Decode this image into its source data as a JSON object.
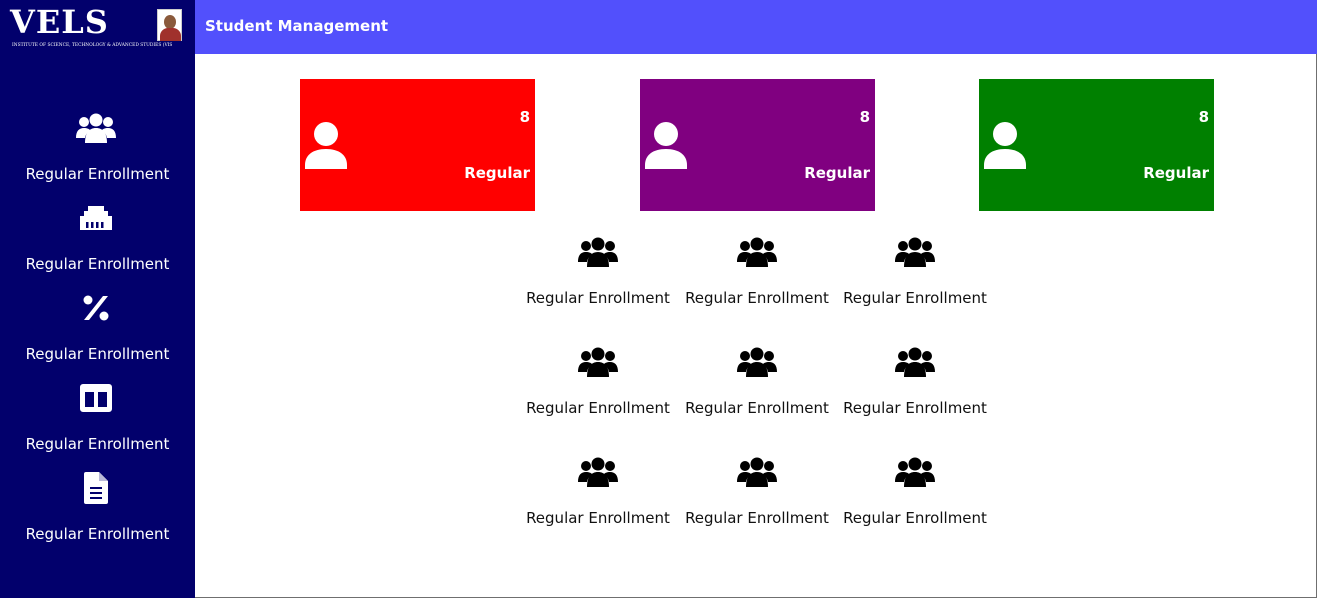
{
  "logo": {
    "text": "VELS",
    "subtitle": "INSTITUTE OF SCIENCE, TECHNOLOGY & ADVANCED STUDIES (VISTAS)"
  },
  "header": {
    "title": "Student Management"
  },
  "sidebar": {
    "items": [
      {
        "label": "Regular Enrollment",
        "icon": "users-icon"
      },
      {
        "label": "Regular Enrollment",
        "icon": "ethernet-port-icon"
      },
      {
        "label": "Regular Enrollment",
        "icon": "percent-icon"
      },
      {
        "label": "Regular Enrollment",
        "icon": "columns-icon"
      },
      {
        "label": "Regular Enrollment",
        "icon": "document-icon"
      }
    ]
  },
  "cards": [
    {
      "count": "8",
      "title": "Regular",
      "color": "#ff0000",
      "icon": "user-icon"
    },
    {
      "count": "8",
      "title": "Regular",
      "color": "#800080",
      "icon": "user-icon"
    },
    {
      "count": "8",
      "title": "Regular",
      "color": "#008000",
      "icon": "user-icon"
    }
  ],
  "grid": {
    "items": [
      {
        "label": "Regular Enrollment",
        "icon": "users-icon"
      },
      {
        "label": "Regular Enrollment",
        "icon": "users-icon"
      },
      {
        "label": "Regular Enrollment",
        "icon": "users-icon"
      },
      {
        "label": "Regular Enrollment",
        "icon": "users-icon"
      },
      {
        "label": "Regular Enrollment",
        "icon": "users-icon"
      },
      {
        "label": "Regular Enrollment",
        "icon": "users-icon"
      },
      {
        "label": "Regular Enrollment",
        "icon": "users-icon"
      },
      {
        "label": "Regular Enrollment",
        "icon": "users-icon"
      },
      {
        "label": "Regular Enrollment",
        "icon": "users-icon"
      }
    ]
  },
  "colors": {
    "sidebar": "#02006c",
    "topbar": "#5250fc"
  }
}
